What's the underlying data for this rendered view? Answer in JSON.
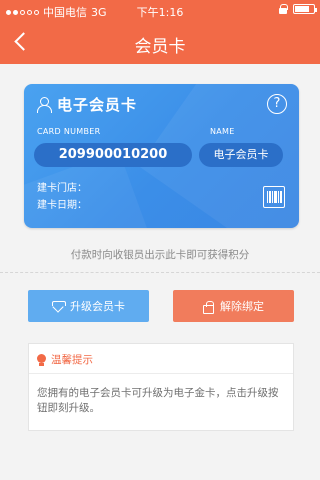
{
  "statusbar": {
    "carrier": "中国电信",
    "network": "3G",
    "time": "下午1:16",
    "signal_bars_filled": 2,
    "signal_bars_total": 5,
    "battery_level": 0.8
  },
  "navbar": {
    "title": "会员卡",
    "back_icon": "chevron-left-icon"
  },
  "card": {
    "title": "电子会员卡",
    "card_number_label": "CARD NUMBER",
    "name_label": "NAME",
    "card_number": "209900010200",
    "name": "电子会员卡",
    "store_label": "建卡门店：",
    "date_label": "建卡日期：",
    "help_glyph": "?",
    "background_color": "#3b8ee8"
  },
  "hint": "付款时向收银员出示此卡即可获得积分",
  "buttons": {
    "upgrade_label": "升级会员卡",
    "unbind_label": "解除绑定",
    "upgrade_color": "#60acf0",
    "unbind_color": "#f17c5c"
  },
  "tips": {
    "title": "温馨提示",
    "body": "您拥有的电子会员卡可升级为电子金卡，点击升级按钮即刻升级。"
  },
  "colors": {
    "brand": "#f26a47"
  }
}
